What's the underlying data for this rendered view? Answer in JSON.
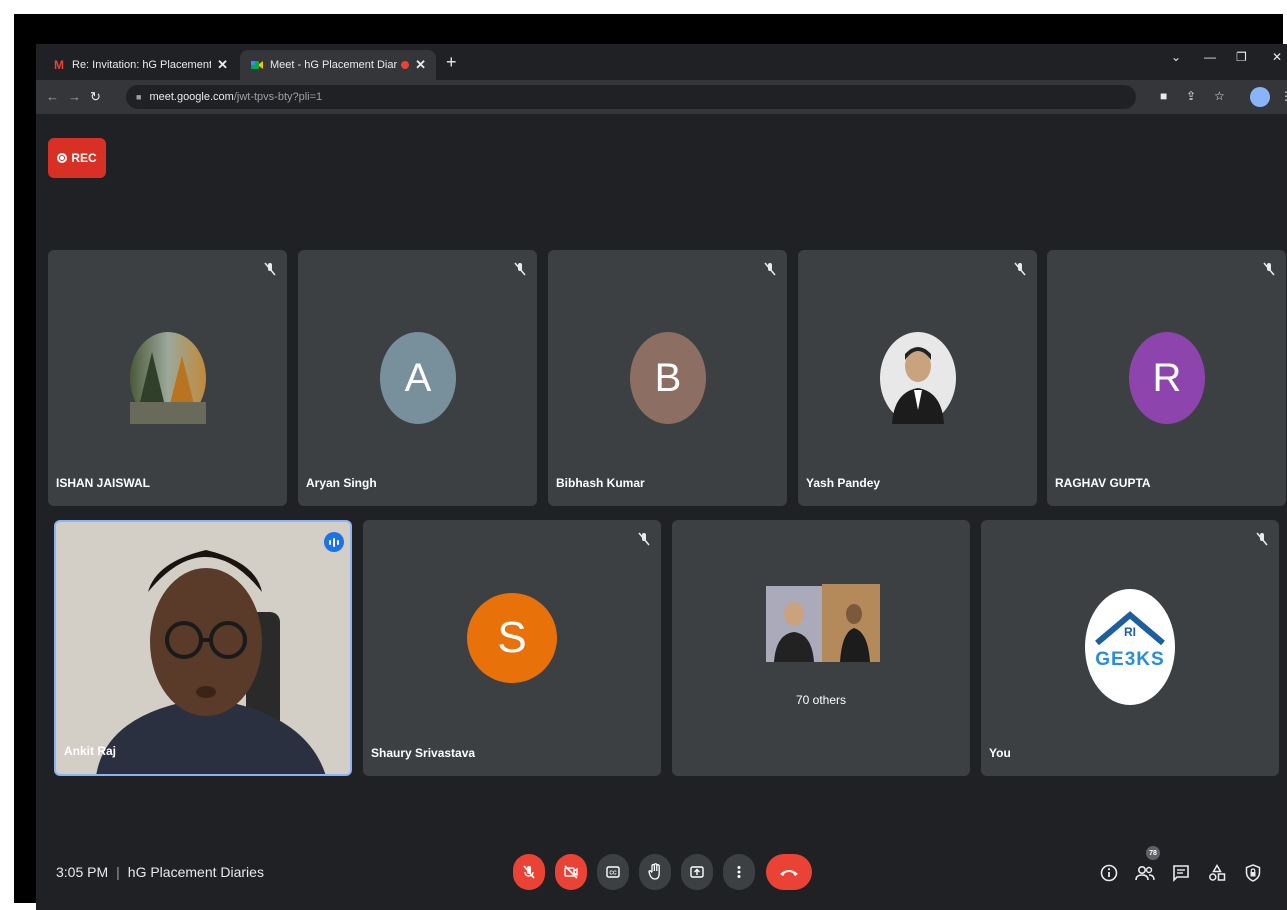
{
  "browser": {
    "tabs": [
      {
        "label": "Re: Invitation: hG Placement Dia"
      },
      {
        "label": "Meet - hG Placement Diaries"
      }
    ],
    "url_host": "meet.google.com",
    "url_path": "/jwt-tpvs-bty?pli=1"
  },
  "recording": {
    "label": "REC"
  },
  "participants": [
    {
      "name": "ISHAN JAISWAL",
      "initial": "",
      "color": "#6b7d5a"
    },
    {
      "name": "Aryan Singh",
      "initial": "A",
      "color": "#78909c"
    },
    {
      "name": "Bibhash Kumar",
      "initial": "B",
      "color": "#8d6e63"
    },
    {
      "name": "Yash Pandey",
      "initial": "",
      "color": "#e8e8e8"
    },
    {
      "name": "RAGHAV GUPTA",
      "initial": "R",
      "color": "#8e44ad"
    },
    {
      "name": "Ankit Raj",
      "initial": "",
      "color": ""
    },
    {
      "name": "Shaury Srivastava",
      "initial": "S",
      "color": "#e8710a"
    },
    {
      "name": "",
      "initial": "",
      "color": ""
    },
    {
      "name": "You",
      "initial": "",
      "color": "#ffffff"
    }
  ],
  "others": {
    "label": "70 others"
  },
  "you_avatar": {
    "top": "RI",
    "bottom": "GE3KS"
  },
  "footer": {
    "time": "3:05 PM",
    "meeting_name": "hG Placement Diaries",
    "people_count": "78"
  }
}
